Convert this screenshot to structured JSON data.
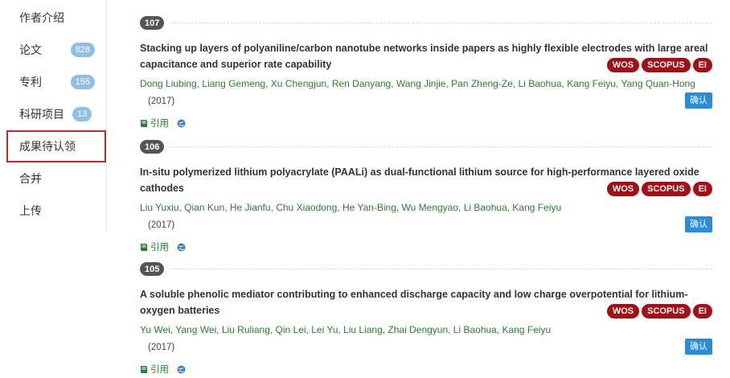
{
  "sidebar": {
    "items": [
      {
        "label": "作者介绍",
        "badge": ""
      },
      {
        "label": "论文",
        "badge": "828"
      },
      {
        "label": "专利",
        "badge": "155"
      },
      {
        "label": "科研项目",
        "badge": "13"
      },
      {
        "label": "成果待认领",
        "badge": ""
      },
      {
        "label": "合并",
        "badge": ""
      },
      {
        "label": "上传",
        "badge": ""
      }
    ]
  },
  "entries": [
    {
      "number": "107",
      "title": "Stacking up layers of polyaniline/carbon nanotube networks inside papers as highly flexible electrodes with large areal capacitance and superior rate capability",
      "tags": [
        "WOS",
        "SCOPUS",
        "EI"
      ],
      "authors": "Dong Liubing, Liang Gemeng, Xu Chengjun, Ren Danyang, Wang Jinjie, Pan Zheng-Ze, Li Baohua, Kang Feiyu, Yang Quan-Hong",
      "year": "(2017)",
      "confirm": "确认",
      "cite": "引用"
    },
    {
      "number": "106",
      "title": "In-situ polymerized lithium polyacrylate (PAALi) as dual-functional lithium source for high-performance layered oxide cathodes",
      "tags": [
        "WOS",
        "SCOPUS",
        "EI"
      ],
      "authors": "Liu Yuxiu, Qian Kun, He Jianfu, Chu Xiaodong, He Yan-Bing, Wu Mengyao, Li Baohua, Kang Feiyu",
      "year": "(2017)",
      "confirm": "确认",
      "cite": "引用"
    },
    {
      "number": "105",
      "title": "A soluble phenolic mediator contributing to enhanced discharge capacity and low charge overpotential for lithium-oxygen batteries",
      "tags": [
        "WOS",
        "SCOPUS",
        "EI"
      ],
      "authors": "Yu Wei, Yang Wei, Liu Ruliang, Qin Lei, Lei Yu, Liu Liang, Zhai Dengyun, Li Baohua, Kang Feiyu",
      "year": "(2017)",
      "confirm": "确认",
      "cite": "引用"
    }
  ],
  "colors": {
    "tag": "#a30f14",
    "confirm": "#2a8bd8",
    "authors": "#2e7d32",
    "badge": "#8fbfe6",
    "selected_border": "#c62828"
  }
}
